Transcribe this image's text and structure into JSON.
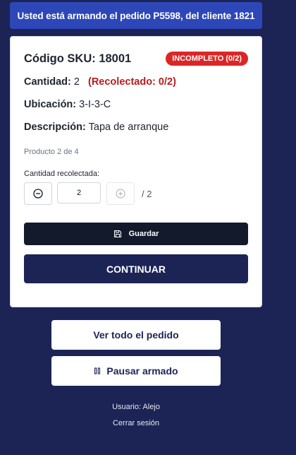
{
  "banner": {
    "text": "Usted está armando el pedido P5598, del cliente 1821"
  },
  "product": {
    "sku_label": "Código SKU: 18001",
    "status_badge": "INCOMPLETO (0/2)",
    "quantity_label": "Cantidad:",
    "quantity_value": "2",
    "collected_text": "(Recolectado: 0/2)",
    "location_label": "Ubicación:",
    "location_value": "3-I-3-C",
    "description_label": "Descripción:",
    "description_value": "Tapa de arranque",
    "progress_text": "Producto 2 de 4"
  },
  "quantity_picker": {
    "label": "Cantidad recolectada:",
    "value": "2",
    "max_text": "/ 2"
  },
  "actions": {
    "save_label": "Guardar",
    "continue_label": "CONTINUAR",
    "view_order_label": "Ver todo el pedido",
    "pause_label": "Pausar armado"
  },
  "footer": {
    "user_text": "Usuario: Alejo",
    "logout_text": "Cerrar sesión"
  },
  "icons": {
    "minus": "minus-circle-icon",
    "plus": "plus-circle-icon",
    "save": "floppy-disk-icon",
    "pause": "pause-icon"
  },
  "colors": {
    "background": "#1c2456",
    "banner": "#2d47b8",
    "badge": "#dc2626",
    "collected": "#b91c1c",
    "save_button": "#121a2b"
  }
}
